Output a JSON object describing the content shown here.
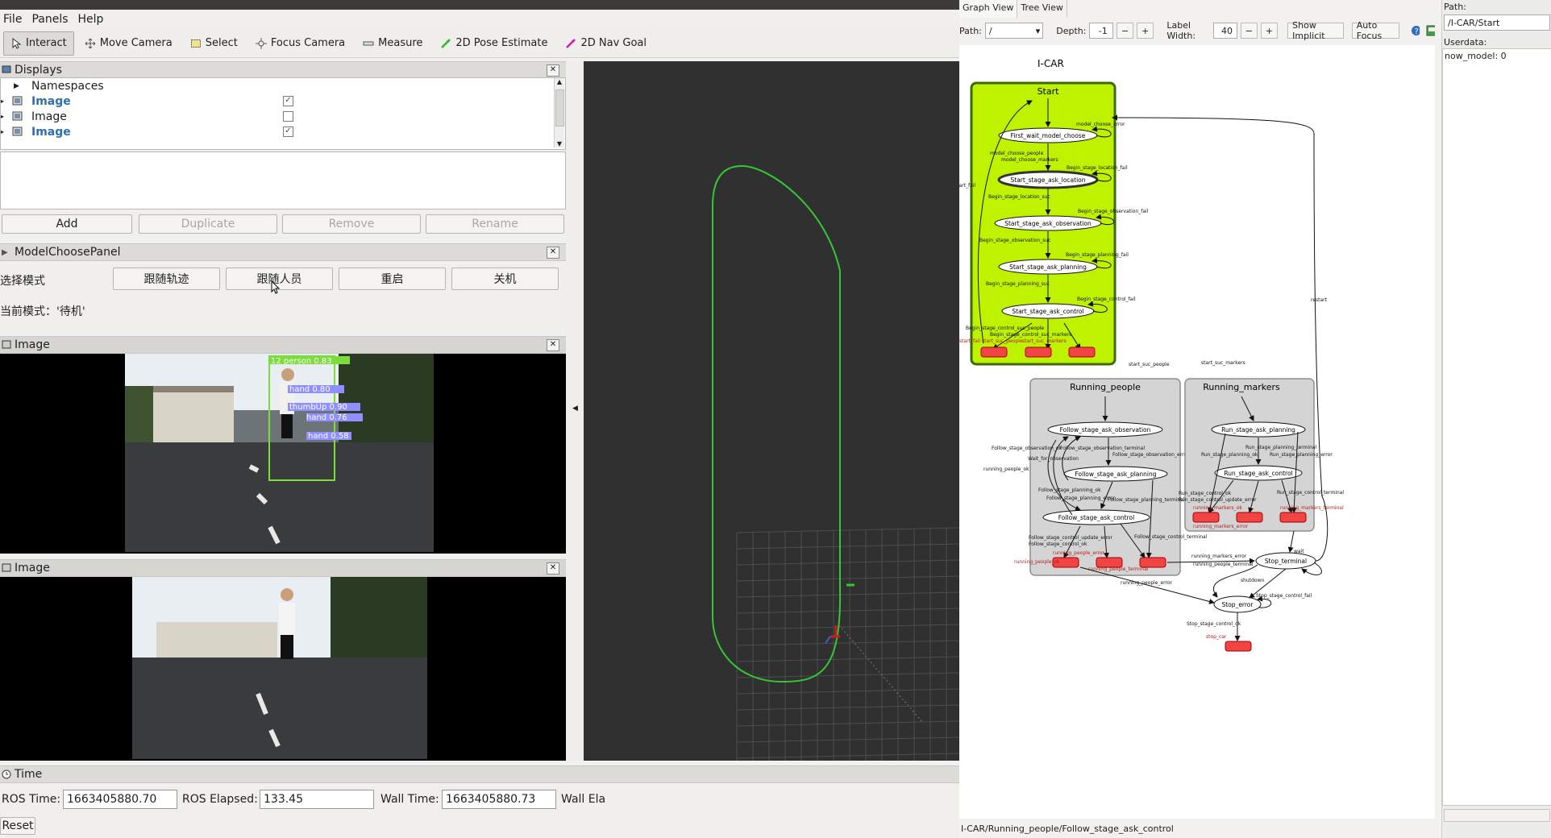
{
  "menu": {
    "file": "File",
    "panels": "Panels",
    "help": "Help"
  },
  "tools": [
    {
      "label": "Interact",
      "icon": "cursor-icon"
    },
    {
      "label": "Move Camera",
      "icon": "move-camera-icon"
    },
    {
      "label": "Select",
      "icon": "select-icon"
    },
    {
      "label": "Focus Camera",
      "icon": "focus-camera-icon"
    },
    {
      "label": "Measure",
      "icon": "measure-icon"
    },
    {
      "label": "2D Pose Estimate",
      "icon": "pose-arrow-icon"
    },
    {
      "label": "2D Nav Goal",
      "icon": "nav-goal-arrow-icon"
    }
  ],
  "displays": {
    "title": "Displays",
    "items": [
      {
        "label": "Namespaces",
        "checked": null
      },
      {
        "label": "Image",
        "checked": true
      },
      {
        "label": "Image",
        "checked": false
      },
      {
        "label": "Image",
        "checked": true
      }
    ],
    "buttons": {
      "add": "Add",
      "duplicate": "Duplicate",
      "remove": "Remove",
      "rename": "Rename"
    }
  },
  "model_panel": {
    "title": "ModelChoosePanel",
    "select_label": "选择模式",
    "buttons": [
      "跟随轨迹",
      "跟随人员",
      "重启",
      "关机"
    ],
    "current_mode": "当前模式：'待机'"
  },
  "image_panels": [
    {
      "title": "Image",
      "detections": [
        {
          "label": "12 person 0.83",
          "color": "#7bdc3c"
        },
        {
          "label": "hand 0.80",
          "color": "#8f8fff"
        },
        {
          "label": "thumbUp 0.90",
          "color": "#8f8fff"
        },
        {
          "label": "hand 0.76",
          "color": "#8f8fff"
        },
        {
          "label": "hand 0.58",
          "color": "#8f8fff"
        }
      ]
    },
    {
      "title": "Image"
    }
  ],
  "time_panel": {
    "title": "Time",
    "ros_time_label": "ROS Time:",
    "ros_time": "1663405880.70",
    "ros_elapsed_label": "ROS Elapsed:",
    "ros_elapsed": "133.45",
    "wall_time_label": "Wall Time:",
    "wall_time": "1663405880.73",
    "wall_elapsed_label": "Wall Ela",
    "reset": "Reset"
  },
  "rqt": {
    "tabs": [
      "Graph View",
      "Tree View"
    ],
    "path_label": "Path:",
    "path_value": "/",
    "depth_label": "Depth:",
    "depth_value": "-1",
    "label_width_label": "Label Width:",
    "label_width_value": "40",
    "show_implicit": "Show Implicit",
    "auto_focus": "Auto Focus",
    "status": "I-CAR/Running_people/Follow_stage_ask_control",
    "right_path_label": "Path:",
    "right_path_value": "/I-CAR/Start",
    "userdata_label": "Userdata:",
    "userdata_value": "now_model: 0",
    "graph": {
      "root": "I-CAR",
      "start": {
        "title": "Start",
        "states": [
          "First_wait_model_choose",
          "Start_stage_ask_location",
          "Start_stage_ask_observation",
          "Start_stage_ask_planning",
          "Start_stage_ask_control"
        ],
        "edges": [
          "model_choose_error",
          "model_choose_people",
          "model_choose_markers",
          "Begin_stage_location_fail",
          "Begin_stage_location_suc",
          "Begin_stage_observation_fail",
          "Begin_stage_observation_suc",
          "Begin_stage_planning_fail",
          "Begin_stage_planning_suc",
          "Begin_stage_control_fail",
          "Begin_stage_control_suc_people",
          "Begin_stage_control_suc_markers",
          "start_fail",
          "start_suc_people",
          "start_suc_markers"
        ]
      },
      "running_people": {
        "title": "Running_people",
        "states": [
          "Follow_stage_ask_observation",
          "Follow_stage_ask_planning",
          "Follow_stage_ask_control"
        ],
        "edges": [
          "Follow_stage_observation_ok",
          "Follow_stage_observation_terminal",
          "Wait_for_observation",
          "Follow_stage_observation_error",
          "Follow_stage_planning_ok",
          "Follow_stage_planning_error",
          "Follow_stage_planning_terminal",
          "Follow_stage_control_update_error",
          "Follow_stage_control_ok",
          "Follow_stage_control_terminal",
          "running_people_error",
          "running_people_ok",
          "running_people_terminal"
        ]
      },
      "running_markers": {
        "title": "Running_markers",
        "states": [
          "Run_stage_ask_planning",
          "Run_stage_ask_control"
        ],
        "edges": [
          "Run_stage_planning_terminal",
          "Run_stage_planning_ok",
          "Run_stage_planning_error",
          "Run_stage_control_ok",
          "Run_stage_control_update_error",
          "Run_stage_control_terminal",
          "running_markers_ok",
          "running_markers_error",
          "running_markers_terminal"
        ]
      },
      "outer_states": [
        "Stop_terminal",
        "Stop_error"
      ],
      "outer_edges": [
        "restart",
        "wait",
        "shutdown",
        "Stop_stage_control_fail",
        "Stop_stage_control_ok",
        "running_people_error",
        "start_fail",
        "start_suc_people",
        "start_suc_markers",
        "running_markers_error",
        "running_people_terminal"
      ],
      "outcome": "stop_car"
    }
  }
}
